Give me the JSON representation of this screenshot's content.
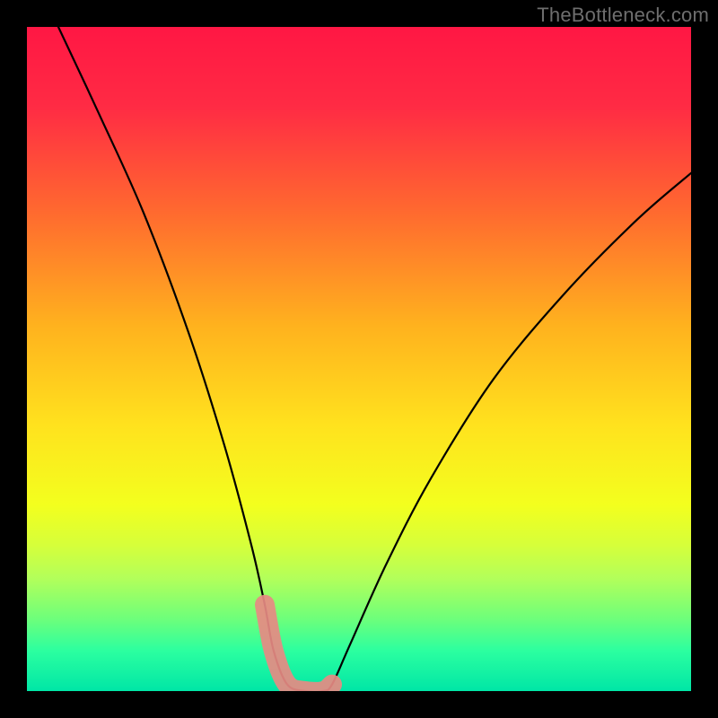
{
  "watermark": "TheBottleneck.com",
  "chart_data": {
    "type": "line",
    "title": "",
    "xlabel": "",
    "ylabel": "",
    "xlim_units": [
      0,
      740
    ],
    "ylim_percent": [
      0,
      100
    ],
    "series": [
      {
        "name": "bottleneck-curve",
        "x_units": [
          35,
          80,
          130,
          180,
          220,
          250,
          265,
          275,
          290,
          310,
          330,
          340,
          360,
          400,
          450,
          520,
          600,
          680,
          740
        ],
        "y_percent": [
          100,
          87,
          72,
          54,
          37,
          22,
          13,
          6,
          1,
          0,
          0,
          1,
          7,
          19,
          32,
          47,
          60,
          71,
          78
        ]
      }
    ],
    "highlight_band": {
      "name": "low-bottleneck-zone",
      "x_units": [
        255,
        345
      ],
      "thickness_px": 22,
      "color": "#e78a83"
    },
    "background_gradient": {
      "type": "linear-vertical",
      "stops_percent_to_color": [
        [
          0,
          "#ff1744"
        ],
        [
          12,
          "#ff2b44"
        ],
        [
          28,
          "#ff6a2f"
        ],
        [
          45,
          "#ffb21e"
        ],
        [
          60,
          "#ffe21e"
        ],
        [
          72,
          "#f3ff1e"
        ],
        [
          78,
          "#d6ff3a"
        ],
        [
          83,
          "#b3ff5a"
        ],
        [
          89,
          "#6fff7a"
        ],
        [
          94,
          "#2bffa0"
        ],
        [
          100,
          "#00e6a6"
        ]
      ]
    }
  }
}
